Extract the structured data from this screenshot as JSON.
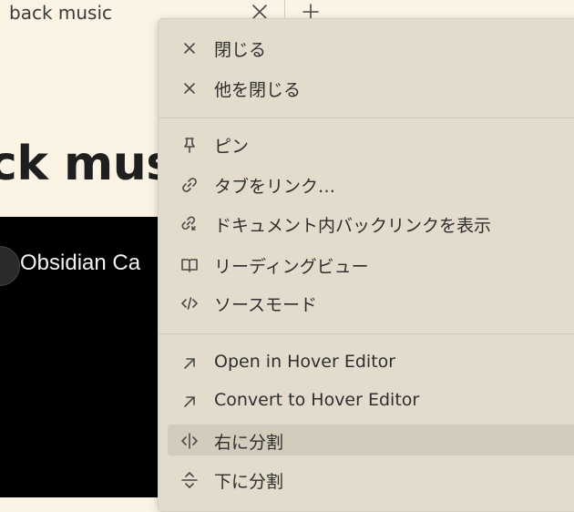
{
  "tab": {
    "title": "back music"
  },
  "note": {
    "title": "ck music"
  },
  "video": {
    "title": "Obsidian Ca"
  },
  "menu": {
    "items": [
      {
        "label": "閉じる",
        "icon": "close-icon"
      },
      {
        "label": "他を閉じる",
        "icon": "close-icon"
      },
      {
        "label": "ピン",
        "icon": "pin-icon"
      },
      {
        "label": "タブをリンク…",
        "icon": "link-icon"
      },
      {
        "label": "ドキュメント内バックリンクを表示",
        "icon": "backlink-icon"
      },
      {
        "label": "リーディングビュー",
        "icon": "book-open-icon"
      },
      {
        "label": "ソースモード",
        "icon": "code-icon"
      },
      {
        "label": "Open in Hover Editor",
        "icon": "arrow-up-right-icon"
      },
      {
        "label": "Convert to Hover Editor",
        "icon": "arrow-up-right-icon"
      },
      {
        "label": "右に分割",
        "icon": "split-vertical-icon"
      },
      {
        "label": "下に分割",
        "icon": "split-horizontal-icon"
      }
    ]
  }
}
